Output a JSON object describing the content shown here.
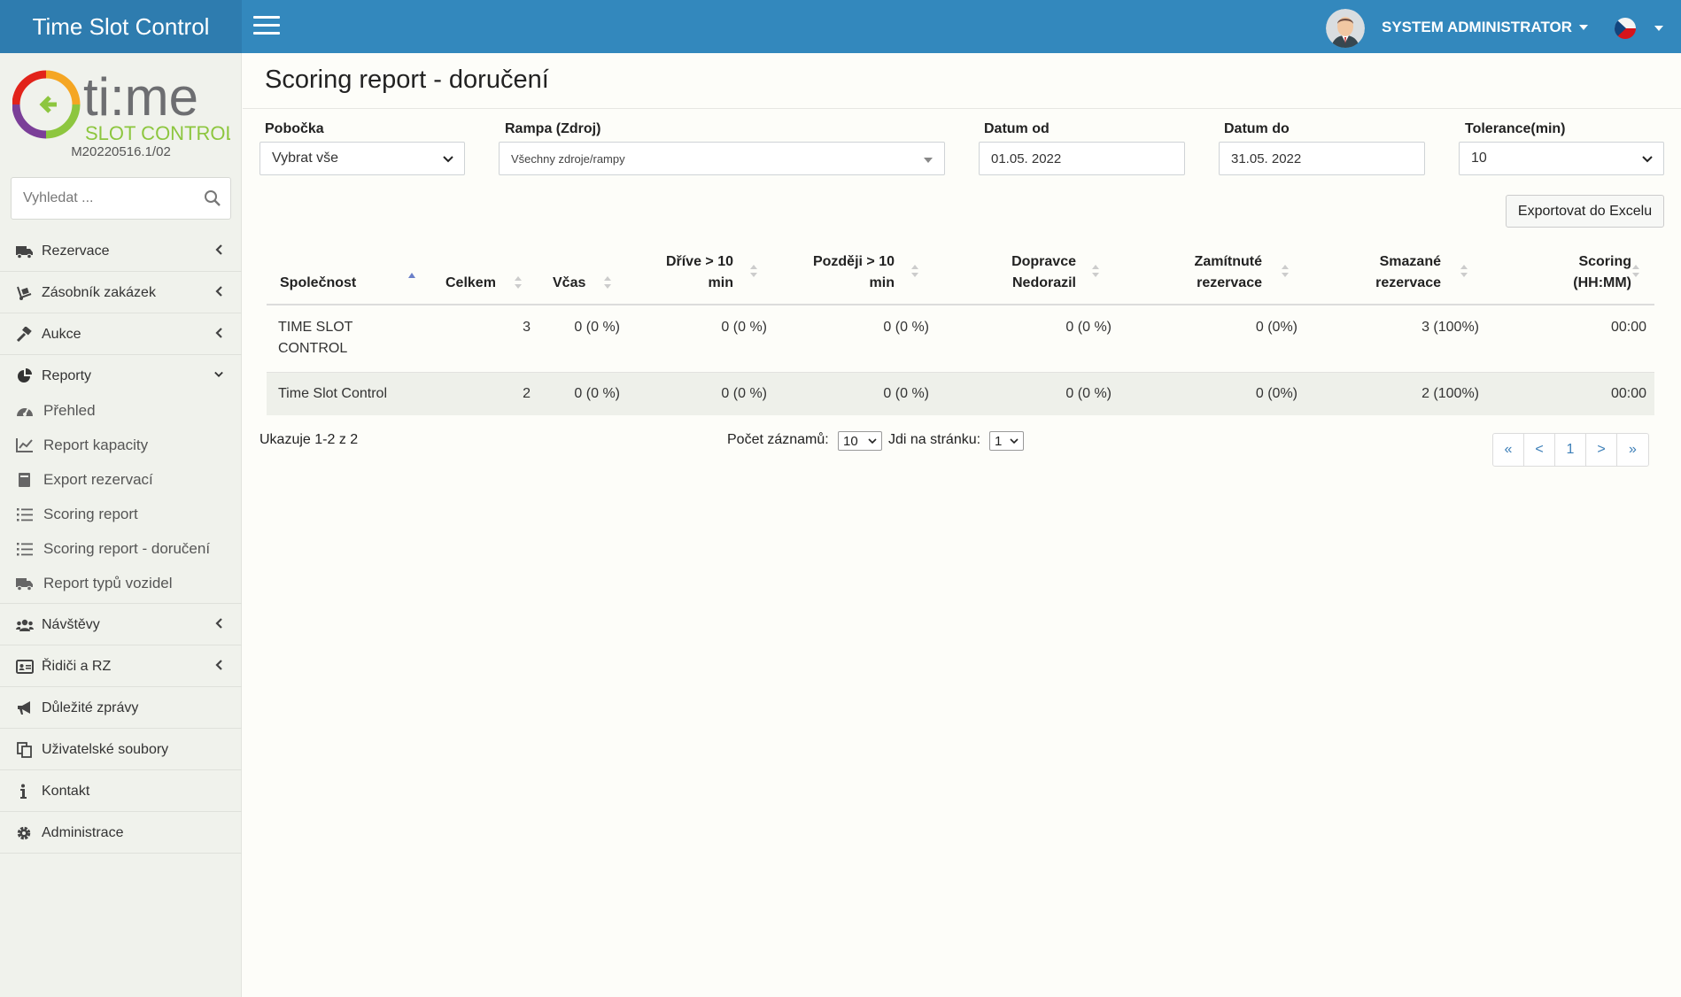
{
  "app": {
    "title": "Time Slot Control",
    "version": "M20220516.1/02"
  },
  "header": {
    "user": "SYSTEM ADMINISTRATOR"
  },
  "sidebar": {
    "search_placeholder": "Vyhledat ...",
    "items": [
      {
        "label": "Rezervace"
      },
      {
        "label": "Zásobník zakázek"
      },
      {
        "label": "Aukce"
      },
      {
        "label": "Reporty"
      },
      {
        "label": "Návštěvy"
      },
      {
        "label": "Řidiči a RZ"
      },
      {
        "label": "Důležité zprávy"
      },
      {
        "label": "Uživatelské soubory"
      },
      {
        "label": "Kontakt"
      },
      {
        "label": "Administrace"
      }
    ],
    "reports_sub": [
      {
        "label": "Přehled"
      },
      {
        "label": "Report kapacity"
      },
      {
        "label": "Export rezervací"
      },
      {
        "label": "Scoring report"
      },
      {
        "label": "Scoring report - doručení"
      },
      {
        "label": "Report typů vozidel"
      }
    ]
  },
  "page": {
    "title": "Scoring report - doručení"
  },
  "filters": {
    "branch": {
      "label": "Pobočka",
      "value": "Vybrat vše"
    },
    "ramp": {
      "label": "Rampa (Zdroj)",
      "value": "Všechny zdroje/rampy"
    },
    "date_from": {
      "label": "Datum od",
      "value": "01.05. 2022"
    },
    "date_to": {
      "label": "Datum do",
      "value": "31.05. 2022"
    },
    "tolerance": {
      "label": "Tolerance(min)",
      "value": "10"
    }
  },
  "export_label": "Exportovat do Excelu",
  "table": {
    "columns": [
      {
        "l1": "",
        "l2": "Společnost"
      },
      {
        "l1": "",
        "l2": "Celkem"
      },
      {
        "l1": "",
        "l2": "Včas"
      },
      {
        "l1": "Dříve > 10",
        "l2": "min"
      },
      {
        "l1": "Později > 10",
        "l2": "min"
      },
      {
        "l1": "Dopravce",
        "l2": "Nedorazil"
      },
      {
        "l1": "Zamítnuté",
        "l2": "rezervace"
      },
      {
        "l1": "Smazané",
        "l2": "rezervace"
      },
      {
        "l1": "Scoring",
        "l2": "(HH:MM)"
      }
    ],
    "rows": [
      {
        "company_l1": "TIME SLOT",
        "company_l2": "CONTROL",
        "total": "3",
        "on_time": "0 (0 %)",
        "early": "0 (0 %)",
        "late": "0 (0 %)",
        "not_arrived": "0 (0 %)",
        "rejected": "0 (0%)",
        "deleted": "3 (100%)",
        "scoring": "00:00"
      },
      {
        "company_l1": "Time Slot Control",
        "company_l2": "",
        "total": "2",
        "on_time": "0 (0 %)",
        "early": "0 (0 %)",
        "late": "0 (0 %)",
        "not_arrived": "0 (0 %)",
        "rejected": "0 (0%)",
        "deleted": "2 (100%)",
        "scoring": "00:00"
      }
    ]
  },
  "pager": {
    "info": "Ukazuje 1-2 z 2",
    "size_label": "Počet záznamů:",
    "size_value": "10",
    "goto_label": "Jdi na stránku:",
    "goto_value": "1",
    "first": "«",
    "prev": "<",
    "page": "1",
    "next": ">",
    "last": "»"
  },
  "colors": {
    "header": "#3388bd",
    "brand": "#2e7caf",
    "sidebar": "#f0f2ec",
    "link": "#3d7fb8"
  }
}
